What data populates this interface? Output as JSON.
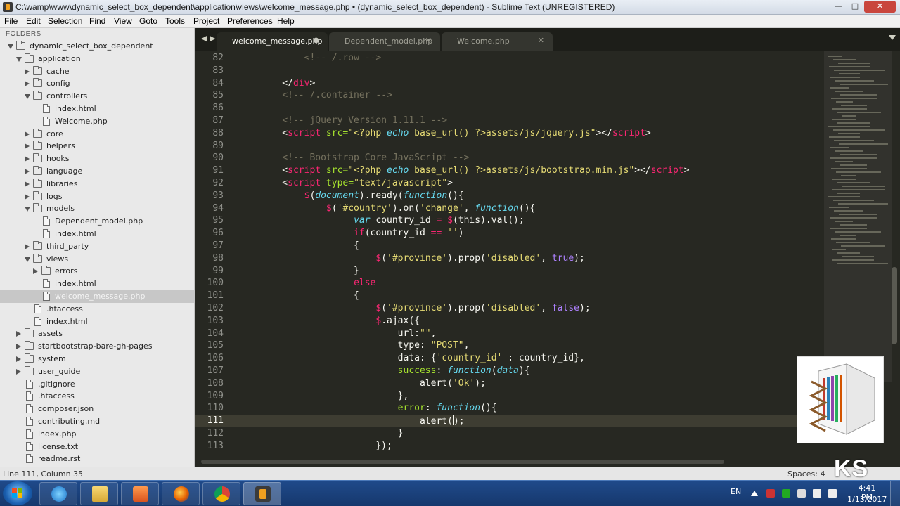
{
  "window": {
    "title": "C:\\wamp\\www\\dynamic_select_box_dependent\\application\\views\\welcome_message.php • (dynamic_select_box_dependent) - Sublime Text (UNREGISTERED)",
    "minimize_glyph": "—",
    "maximize_glyph": "□",
    "close_glyph": "✕"
  },
  "menu": [
    "File",
    "Edit",
    "Selection",
    "Find",
    "View",
    "Goto",
    "Tools",
    "Project",
    "Preferences",
    "Help"
  ],
  "sidebar": {
    "header": "FOLDERS",
    "items": [
      {
        "label": "dynamic_select_box_dependent",
        "depth": 0,
        "type": "folder",
        "open": true
      },
      {
        "label": "application",
        "depth": 1,
        "type": "folder",
        "open": true
      },
      {
        "label": "cache",
        "depth": 2,
        "type": "folder",
        "open": false
      },
      {
        "label": "config",
        "depth": 2,
        "type": "folder",
        "open": false
      },
      {
        "label": "controllers",
        "depth": 2,
        "type": "folder",
        "open": true
      },
      {
        "label": "index.html",
        "depth": 3,
        "type": "file"
      },
      {
        "label": "Welcome.php",
        "depth": 3,
        "type": "file"
      },
      {
        "label": "core",
        "depth": 2,
        "type": "folder",
        "open": false
      },
      {
        "label": "helpers",
        "depth": 2,
        "type": "folder",
        "open": false
      },
      {
        "label": "hooks",
        "depth": 2,
        "type": "folder",
        "open": false
      },
      {
        "label": "language",
        "depth": 2,
        "type": "folder",
        "open": false
      },
      {
        "label": "libraries",
        "depth": 2,
        "type": "folder",
        "open": false
      },
      {
        "label": "logs",
        "depth": 2,
        "type": "folder",
        "open": false
      },
      {
        "label": "models",
        "depth": 2,
        "type": "folder",
        "open": true
      },
      {
        "label": "Dependent_model.php",
        "depth": 3,
        "type": "file"
      },
      {
        "label": "index.html",
        "depth": 3,
        "type": "file"
      },
      {
        "label": "third_party",
        "depth": 2,
        "type": "folder",
        "open": false
      },
      {
        "label": "views",
        "depth": 2,
        "type": "folder",
        "open": true
      },
      {
        "label": "errors",
        "depth": 3,
        "type": "folder",
        "open": false
      },
      {
        "label": "index.html",
        "depth": 3,
        "type": "file"
      },
      {
        "label": "welcome_message.php",
        "depth": 3,
        "type": "file",
        "selected": true
      },
      {
        "label": ".htaccess",
        "depth": 2,
        "type": "file"
      },
      {
        "label": "index.html",
        "depth": 2,
        "type": "file"
      },
      {
        "label": "assets",
        "depth": 1,
        "type": "folder",
        "open": false
      },
      {
        "label": "startbootstrap-bare-gh-pages",
        "depth": 1,
        "type": "folder",
        "open": false
      },
      {
        "label": "system",
        "depth": 1,
        "type": "folder",
        "open": false
      },
      {
        "label": "user_guide",
        "depth": 1,
        "type": "folder",
        "open": false
      },
      {
        "label": ".gitignore",
        "depth": 1,
        "type": "file"
      },
      {
        "label": ".htaccess",
        "depth": 1,
        "type": "file"
      },
      {
        "label": "composer.json",
        "depth": 1,
        "type": "file"
      },
      {
        "label": "contributing.md",
        "depth": 1,
        "type": "file"
      },
      {
        "label": "index.php",
        "depth": 1,
        "type": "file"
      },
      {
        "label": "license.txt",
        "depth": 1,
        "type": "file"
      },
      {
        "label": "readme.rst",
        "depth": 1,
        "type": "file"
      }
    ]
  },
  "tabs": [
    {
      "label": "welcome_message.php",
      "active": true,
      "close": "●"
    },
    {
      "label": "Dependent_model.php",
      "active": false,
      "close": "✕"
    },
    {
      "label": "Welcome.php",
      "active": false,
      "close": "✕"
    }
  ],
  "tab_nav": "◀ ▶",
  "editor": {
    "current_line": 111,
    "lines": [
      {
        "n": "82",
        "tokens": [
          [
            "        ",
            "p"
          ],
          [
            "<!-- /.row -->",
            "c"
          ]
        ]
      },
      {
        "n": "83",
        "tokens": []
      },
      {
        "n": "84",
        "tokens": [
          [
            "    </",
            "p"
          ],
          [
            "div",
            "t"
          ],
          [
            ">",
            "p"
          ]
        ]
      },
      {
        "n": "85",
        "tokens": [
          [
            "    ",
            "p"
          ],
          [
            "<!-- /.container -->",
            "c"
          ]
        ]
      },
      {
        "n": "86",
        "tokens": []
      },
      {
        "n": "87",
        "tokens": [
          [
            "    ",
            "p"
          ],
          [
            "<!-- jQuery Version 1.11.1 -->",
            "c"
          ]
        ]
      },
      {
        "n": "88",
        "tokens": [
          [
            "    <",
            "p"
          ],
          [
            "script",
            "t"
          ],
          [
            " src=",
            "a"
          ],
          [
            "\"<?php ",
            "s"
          ],
          [
            "echo",
            "f"
          ],
          [
            " base_url() ?>assets/js/jquery.js\"",
            "s"
          ],
          [
            "></",
            "p"
          ],
          [
            "script",
            "t"
          ],
          [
            ">",
            "p"
          ]
        ]
      },
      {
        "n": "89",
        "tokens": []
      },
      {
        "n": "90",
        "tokens": [
          [
            "    ",
            "p"
          ],
          [
            "<!-- Bootstrap Core JavaScript -->",
            "c"
          ]
        ]
      },
      {
        "n": "91",
        "tokens": [
          [
            "    <",
            "p"
          ],
          [
            "script",
            "t"
          ],
          [
            " src=",
            "a"
          ],
          [
            "\"<?php ",
            "s"
          ],
          [
            "echo",
            "f"
          ],
          [
            " base_url() ?>assets/js/bootstrap.min.js\"",
            "s"
          ],
          [
            "></",
            "p"
          ],
          [
            "script",
            "t"
          ],
          [
            ">",
            "p"
          ]
        ]
      },
      {
        "n": "92",
        "tokens": [
          [
            "    <",
            "p"
          ],
          [
            "script",
            "t"
          ],
          [
            " type=",
            "a"
          ],
          [
            "\"text/javascript\"",
            "s"
          ],
          [
            ">",
            "p"
          ]
        ]
      },
      {
        "n": "93",
        "tokens": [
          [
            "        ",
            "p"
          ],
          [
            "$",
            "k"
          ],
          [
            "(",
            "p"
          ],
          [
            "document",
            "f"
          ],
          [
            ").ready(",
            "p"
          ],
          [
            "function",
            "f"
          ],
          [
            "(){",
            "p"
          ]
        ]
      },
      {
        "n": "94",
        "tokens": [
          [
            "            ",
            "p"
          ],
          [
            "$",
            "k"
          ],
          [
            "(",
            "p"
          ],
          [
            "'#country'",
            "s"
          ],
          [
            ").on(",
            "p"
          ],
          [
            "'change'",
            "s"
          ],
          [
            ", ",
            "p"
          ],
          [
            "function",
            "f"
          ],
          [
            "(){",
            "p"
          ]
        ]
      },
      {
        "n": "95",
        "tokens": [
          [
            "                 ",
            "p"
          ],
          [
            "var",
            "f"
          ],
          [
            " country_id ",
            "p"
          ],
          [
            "=",
            "k"
          ],
          [
            " ",
            "p"
          ],
          [
            "$",
            "k"
          ],
          [
            "(this).val();",
            "p"
          ]
        ]
      },
      {
        "n": "96",
        "tokens": [
          [
            "                 ",
            "p"
          ],
          [
            "if",
            "k"
          ],
          [
            "(country_id ",
            "p"
          ],
          [
            "==",
            "k"
          ],
          [
            " ",
            "p"
          ],
          [
            "''",
            "s"
          ],
          [
            ")",
            "p"
          ]
        ]
      },
      {
        "n": "97",
        "tokens": [
          [
            "                 {",
            "p"
          ]
        ]
      },
      {
        "n": "98",
        "tokens": [
          [
            "                     ",
            "p"
          ],
          [
            "$",
            "k"
          ],
          [
            "(",
            "p"
          ],
          [
            "'#province'",
            "s"
          ],
          [
            ").prop(",
            "p"
          ],
          [
            "'disabled'",
            "s"
          ],
          [
            ", ",
            "p"
          ],
          [
            "true",
            "n"
          ],
          [
            ");",
            "p"
          ]
        ]
      },
      {
        "n": "99",
        "tokens": [
          [
            "                 }",
            "p"
          ]
        ]
      },
      {
        "n": "100",
        "tokens": [
          [
            "                 ",
            "p"
          ],
          [
            "else",
            "k"
          ]
        ]
      },
      {
        "n": "101",
        "tokens": [
          [
            "                 {",
            "p"
          ]
        ]
      },
      {
        "n": "102",
        "tokens": [
          [
            "                     ",
            "p"
          ],
          [
            "$",
            "k"
          ],
          [
            "(",
            "p"
          ],
          [
            "'#province'",
            "s"
          ],
          [
            ").prop(",
            "p"
          ],
          [
            "'disabled'",
            "s"
          ],
          [
            ", ",
            "p"
          ],
          [
            "false",
            "n"
          ],
          [
            ");",
            "p"
          ]
        ]
      },
      {
        "n": "103",
        "tokens": [
          [
            "                     ",
            "p"
          ],
          [
            "$",
            "k"
          ],
          [
            ".ajax({",
            "p"
          ]
        ]
      },
      {
        "n": "104",
        "tokens": [
          [
            "                         url:",
            "p"
          ],
          [
            "\"\"",
            "s"
          ],
          [
            ",",
            "p"
          ]
        ]
      },
      {
        "n": "105",
        "tokens": [
          [
            "                         type: ",
            "p"
          ],
          [
            "\"POST\"",
            "s"
          ],
          [
            ",",
            "p"
          ]
        ]
      },
      {
        "n": "106",
        "tokens": [
          [
            "                         data: {",
            "p"
          ],
          [
            "'country_id'",
            "s"
          ],
          [
            " : country_id},",
            "p"
          ]
        ]
      },
      {
        "n": "107",
        "tokens": [
          [
            "                         ",
            "p"
          ],
          [
            "success",
            "a"
          ],
          [
            ": ",
            "p"
          ],
          [
            "function",
            "f"
          ],
          [
            "(",
            "p"
          ],
          [
            "data",
            "f"
          ],
          [
            "){",
            "p"
          ]
        ]
      },
      {
        "n": "108",
        "tokens": [
          [
            "                             alert(",
            "p"
          ],
          [
            "'Ok'",
            "s"
          ],
          [
            ");",
            "p"
          ]
        ]
      },
      {
        "n": "109",
        "tokens": [
          [
            "                         },",
            "p"
          ]
        ]
      },
      {
        "n": "110",
        "tokens": [
          [
            "                         ",
            "p"
          ],
          [
            "error",
            "a"
          ],
          [
            ": ",
            "p"
          ],
          [
            "function",
            "f"
          ],
          [
            "(){",
            "p"
          ]
        ]
      },
      {
        "n": "111",
        "tokens": [
          [
            "                             alert(",
            "p"
          ],
          [
            "|",
            "cursor"
          ],
          [
            ");",
            "p"
          ]
        ]
      },
      {
        "n": "112",
        "tokens": [
          [
            "                         }",
            "p"
          ]
        ]
      },
      {
        "n": "113",
        "tokens": [
          [
            "                     });",
            "p"
          ]
        ]
      }
    ]
  },
  "status": {
    "position": "Line 111, Column 35",
    "indent": "Spaces: 4"
  },
  "watermark": "KS",
  "taskbar": {
    "apps": [
      "internet-explorer",
      "file-explorer",
      "media-player",
      "firefox",
      "chrome",
      "sublime-text"
    ],
    "active_app": "sublime-text",
    "language": "EN",
    "time": "4:41 PM",
    "date": "1/13/2017"
  },
  "colors": {
    "editor_bg": "#272822",
    "comment": "#75715e",
    "keyword": "#f92672",
    "string": "#e6db74",
    "function": "#66d9ef",
    "number": "#ae81ff",
    "attribute": "#a6e22e"
  }
}
